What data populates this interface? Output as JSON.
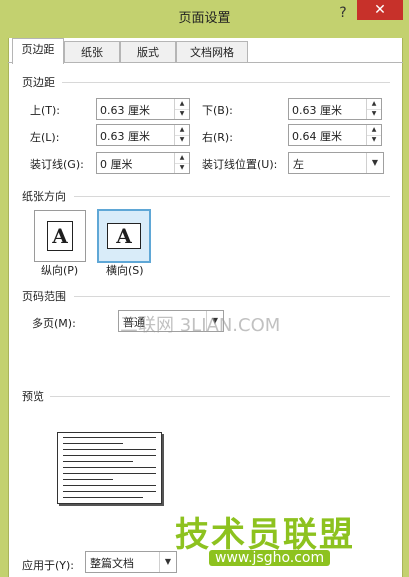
{
  "window": {
    "title": "页面设置",
    "help_glyph": "?",
    "close_glyph": "✕"
  },
  "tabs": [
    "页边距",
    "纸张",
    "版式",
    "文档网格"
  ],
  "margins": {
    "section": "页边距",
    "top_label": "上(T):",
    "top_value": "0.63 厘米",
    "bottom_label": "下(B):",
    "bottom_value": "0.63 厘米",
    "left_label": "左(L):",
    "left_value": "0.63 厘米",
    "right_label": "右(R):",
    "right_value": "0.64 厘米",
    "gutter_label": "装订线(G):",
    "gutter_value": "0 厘米",
    "gutter_pos_label": "装订线位置(U):",
    "gutter_pos_value": "左"
  },
  "orientation": {
    "section": "纸张方向",
    "doc_glyph": "A",
    "portrait_label": "纵向(P)",
    "landscape_label": "横向(S)",
    "selected": "landscape"
  },
  "pages": {
    "section": "页码范围",
    "multi_label": "多页(M):",
    "multi_value": "普通"
  },
  "preview": {
    "section": "预览"
  },
  "apply": {
    "label": "应用于(Y):",
    "value": "整篇文档"
  },
  "watermark": "三联网 3LIAN.COM",
  "logo": {
    "text": "技术员联盟",
    "url": "www.jsgho.com"
  }
}
